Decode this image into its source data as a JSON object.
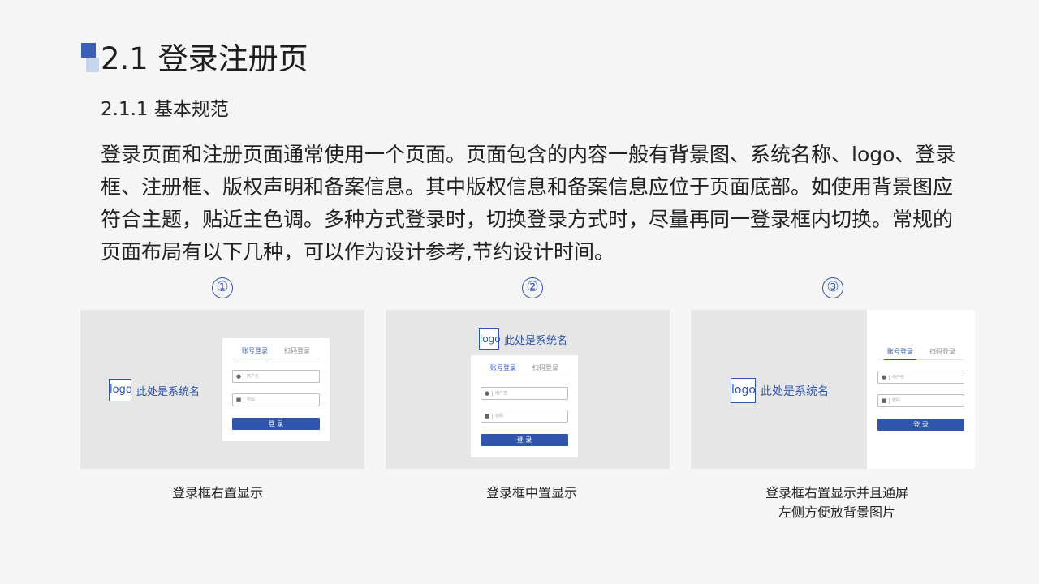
{
  "page_title": "2.1 登录注册页",
  "section_title": "2.1.1 基本规范",
  "body_text": "登录页面和注册页面通常使用一个页面。页面包含的内容一般有背景图、系统名称、logo、登录框、注册框、版权声明和备案信息。其中版权信息和备案信息应位于页面底部。如使用背景图应符合主题，贴近主色调。多种方式登录时，切换登录方式时，尽量再同一登录框内切换。常规的页面布局有以下几种，可以作为设计参考,节约设计时间。",
  "accent_color": "#2f55ad",
  "examples": [
    {
      "number": "①",
      "logo": "logo",
      "system_name": "此处是系统名",
      "tab_active": "账号登录",
      "tab_inactive": "扫码登录",
      "username_placeholder": "用户名",
      "password_placeholder": "密码",
      "login_button": "登 录",
      "caption": "登录框右置显示"
    },
    {
      "number": "②",
      "logo": "logo",
      "system_name": "此处是系统名",
      "tab_active": "账号登录",
      "tab_inactive": "扫码登录",
      "username_placeholder": "用户名",
      "password_placeholder": "密码",
      "login_button": "登 录",
      "caption": "登录框中置显示"
    },
    {
      "number": "③",
      "logo": "logo",
      "system_name": "此处是系统名",
      "tab_active": "账号登录",
      "tab_inactive": "扫码登录",
      "username_placeholder": "用户名",
      "password_placeholder": "密码",
      "login_button": "登 录",
      "caption_line1": "登录框右置显示并且通屏",
      "caption_line2": "左侧方便放背景图片"
    }
  ]
}
